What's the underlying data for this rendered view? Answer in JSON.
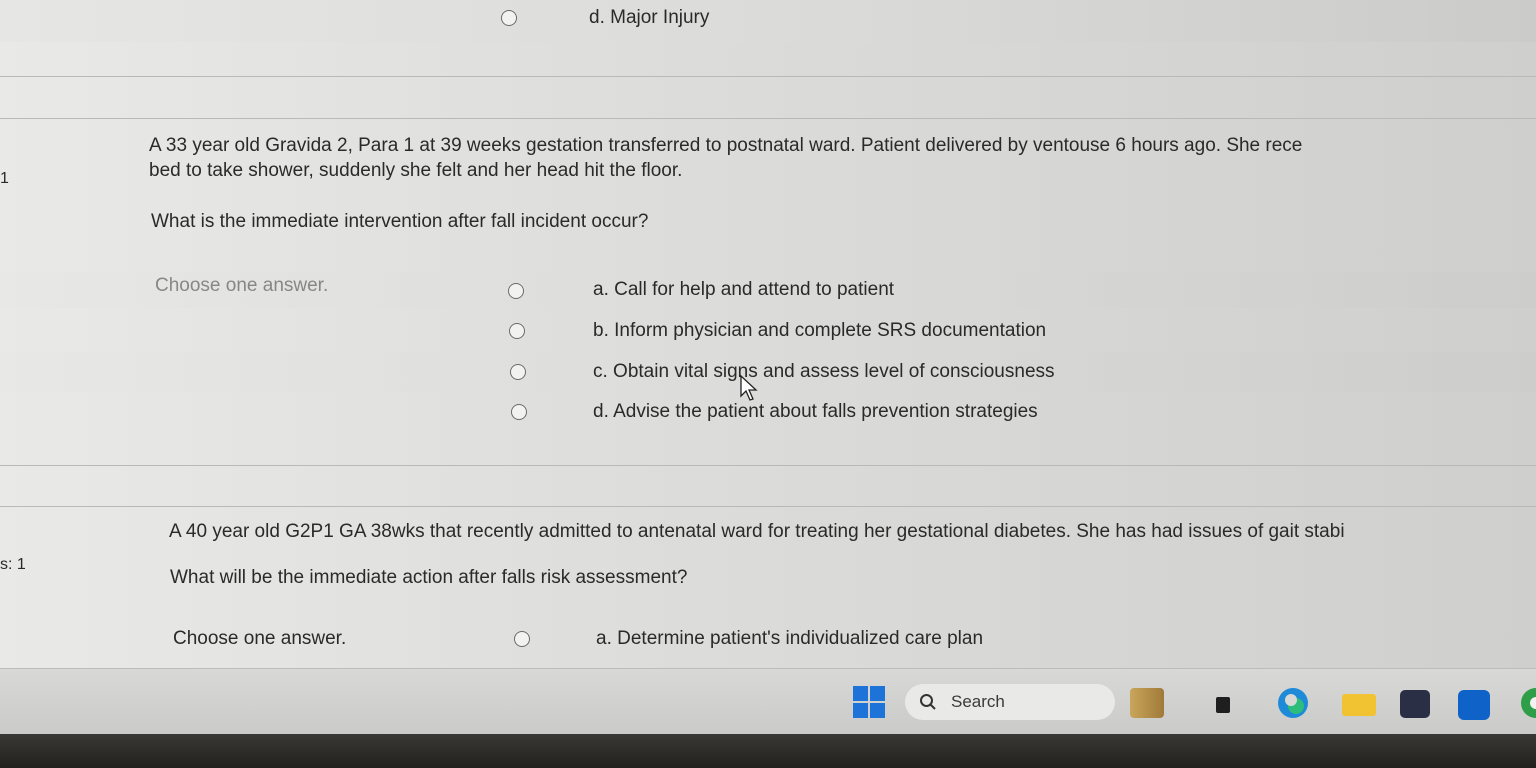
{
  "prev_question": {
    "option_d": "d. Major Injury"
  },
  "question1": {
    "number": "1",
    "stem_line1": "A 33 year old Gravida 2, Para 1 at 39 weeks gestation transferred to postnatal ward. Patient delivered by ventouse 6 hours ago. She rece",
    "stem_line2": "bed to take shower, suddenly she felt and her head hit the floor.",
    "question": "What is the immediate intervention after fall incident occur?",
    "choose_label": "Choose one answer.",
    "options": [
      {
        "label": "a. Call for help and attend to patient"
      },
      {
        "label": "b. Inform physician and complete SRS documentation"
      },
      {
        "label": "c. Obtain vital signs and assess level of consciousness"
      },
      {
        "label": "d. Advise the patient about falls prevention strategies"
      }
    ]
  },
  "question2": {
    "marks_fragment": "s: 1",
    "stem_line1": "A 40 year old G2P1 GA 38wks that recently admitted to antenatal ward for treating her gestational diabetes. She has had issues of gait stabi",
    "question": "What will be the immediate action after falls risk assessment?",
    "choose_label": "Choose one answer.",
    "options": [
      {
        "label": "a. Determine patient's individualized care plan"
      }
    ]
  },
  "taskbar": {
    "search_label": "Search",
    "icons": [
      "windows-start-icon",
      "search-icon",
      "weather-widget-icon",
      "taskview-icon",
      "edge-browser-icon",
      "file-explorer-icon",
      "store-icon",
      "outlook-icon",
      "chrome-icon"
    ]
  },
  "colors": {
    "page_bg": "#dcdcda",
    "text": "#2a2a2a",
    "accent_blue": "#1e73d8"
  }
}
